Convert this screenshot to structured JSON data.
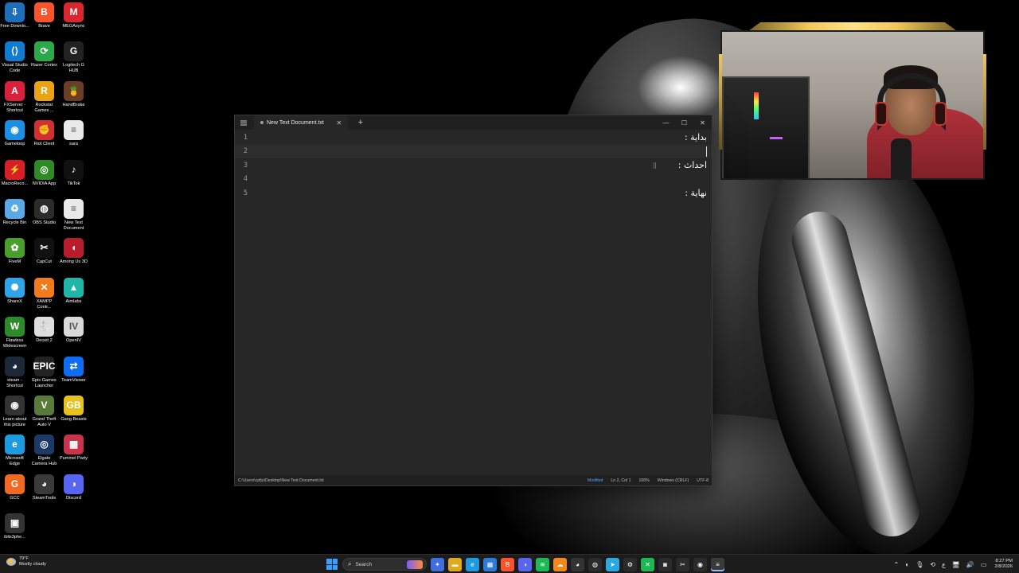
{
  "desktop": {
    "icons": [
      {
        "label": "Free Downlo...",
        "icon": "download-manager-icon",
        "color": "#1c6fb8",
        "glyph": "⇩"
      },
      {
        "label": "Brave",
        "icon": "brave-icon",
        "color": "#fb542b",
        "glyph": "B"
      },
      {
        "label": "MEGAsync",
        "icon": "mega-icon",
        "color": "#d9272e",
        "glyph": "M"
      },
      {
        "label": "Visual Studio Code",
        "icon": "vscode-icon",
        "color": "#0f7bd1",
        "glyph": "⟨⟩"
      },
      {
        "label": "Razer Cortex",
        "icon": "razer-icon",
        "color": "#2ba84a",
        "glyph": "⟳"
      },
      {
        "label": "Logitech G HUB",
        "icon": "logitech-icon",
        "color": "#222222",
        "glyph": "G"
      },
      {
        "label": "FXServer - Shortcut",
        "icon": "fxserver-icon",
        "color": "#d9213c",
        "glyph": "A"
      },
      {
        "label": "Rockstar Games ...",
        "icon": "rockstar-icon",
        "color": "#e8a317",
        "glyph": "R"
      },
      {
        "label": "HandBrake",
        "icon": "handbrake-icon",
        "color": "#6b3e26",
        "glyph": "🍍"
      },
      {
        "label": "Gameloop",
        "icon": "gameloop-icon",
        "color": "#1a8fe3",
        "glyph": "◉"
      },
      {
        "label": "Riot Client",
        "icon": "riot-icon",
        "color": "#d22f35",
        "glyph": "✊"
      },
      {
        "label": "sara",
        "icon": "text-file-icon",
        "color": "#e9e9e9",
        "glyph": "≡"
      },
      {
        "label": "MacroReco...",
        "icon": "macro-recorder-icon",
        "color": "#d91e26",
        "glyph": "⚡"
      },
      {
        "label": "NVIDIA App",
        "icon": "nvidia-icon",
        "color": "#2f8a24",
        "glyph": "◎"
      },
      {
        "label": "TikTok",
        "icon": "tiktok-icon",
        "color": "#111111",
        "glyph": "♪"
      },
      {
        "label": "Recycle Bin",
        "icon": "recycle-bin-icon",
        "color": "#5aa9e6",
        "glyph": "♻"
      },
      {
        "label": "OBS Studio",
        "icon": "obs-icon",
        "color": "#2b2b2b",
        "glyph": "◍"
      },
      {
        "label": "New Text Document",
        "icon": "text-file-icon",
        "color": "#e9e9e9",
        "glyph": "≡"
      },
      {
        "label": "FiveM",
        "icon": "fivem-icon",
        "color": "#4a9e2c",
        "glyph": "✿"
      },
      {
        "label": "CapCut",
        "icon": "capcut-icon",
        "color": "#111111",
        "glyph": "✂"
      },
      {
        "label": "Among Us 3D",
        "icon": "among-us-icon",
        "color": "#b81d2c",
        "glyph": "◖"
      },
      {
        "label": "ShareX",
        "icon": "sharex-icon",
        "color": "#2fa4e7",
        "glyph": "✺"
      },
      {
        "label": "XAMPP Contr...",
        "icon": "xampp-icon",
        "color": "#f27a1a",
        "glyph": "✕"
      },
      {
        "label": "Aimlabs",
        "icon": "aimlabs-icon",
        "color": "#1fb5a8",
        "glyph": "▲"
      },
      {
        "label": "Flawless Widescreen",
        "icon": "flawless-widescreen-icon",
        "color": "#2d8a2a",
        "glyph": "W"
      },
      {
        "label": "Deceit 2",
        "icon": "deceit-icon",
        "color": "#dddddd",
        "glyph": "🐇"
      },
      {
        "label": "OpenIV",
        "icon": "openiv-icon",
        "color": "#d9d9d9",
        "glyph": "IV"
      },
      {
        "label": "steam - Shortcut",
        "icon": "steam-icon",
        "color": "#1b2838",
        "glyph": "◕"
      },
      {
        "label": "Epic Games Launcher",
        "icon": "epic-games-icon",
        "color": "#222222",
        "glyph": "EPIC"
      },
      {
        "label": "TeamViewer",
        "icon": "teamviewer-icon",
        "color": "#0e6cf5",
        "glyph": "⇄"
      },
      {
        "label": "Learn about this picture",
        "icon": "spotlight-icon",
        "color": "#333333",
        "glyph": "◉"
      },
      {
        "label": "Grand Theft Auto V",
        "icon": "gta-icon",
        "color": "#5a7a3a",
        "glyph": "V"
      },
      {
        "label": "Gang Beasts",
        "icon": "gang-beasts-icon",
        "color": "#e6c21f",
        "glyph": "GB"
      },
      {
        "label": "Microsoft Edge",
        "icon": "edge-icon",
        "color": "#1e9be0",
        "glyph": "e"
      },
      {
        "label": "Elgato Camera Hub",
        "icon": "elgato-icon",
        "color": "#1c3a66",
        "glyph": "◎"
      },
      {
        "label": "Pummel Party",
        "icon": "pummel-party-icon",
        "color": "#c8344a",
        "glyph": "▦"
      },
      {
        "label": "GCC",
        "icon": "gcc-icon",
        "color": "#f06a21",
        "glyph": "G"
      },
      {
        "label": "SteamTools",
        "icon": "steamtools-icon",
        "color": "#3a3a3a",
        "glyph": "◕"
      },
      {
        "label": "Discord",
        "icon": "discord-icon",
        "color": "#5865f2",
        "glyph": "◑"
      },
      {
        "label": "iblis3phe...",
        "icon": "image-file-icon",
        "color": "#333333",
        "glyph": "▣"
      }
    ]
  },
  "notepad": {
    "tab_title": "New Text Document.txt",
    "lines": [
      {
        "num": "1",
        "text": "بداية :"
      },
      {
        "num": "2",
        "text": ""
      },
      {
        "num": "3",
        "text": "احداث :"
      },
      {
        "num": "4",
        "text": ""
      },
      {
        "num": "5",
        "text": "نهاية :"
      }
    ],
    "current_line": 2,
    "status": {
      "path": "C:\\Users\\cpfju\\Desktop\\New Text Document.txt",
      "modified": "Modified",
      "position": "Ln 2, Col 1",
      "zoom": "100%",
      "line_ending": "Windows (CRLF)",
      "encoding": "UTF-8"
    }
  },
  "taskbar": {
    "weather_temp": "79°F",
    "weather_desc": "Mostly cloudy",
    "search_placeholder": "Search",
    "time": "8:27 PM",
    "date": "2/8/2026",
    "language": "ع"
  }
}
